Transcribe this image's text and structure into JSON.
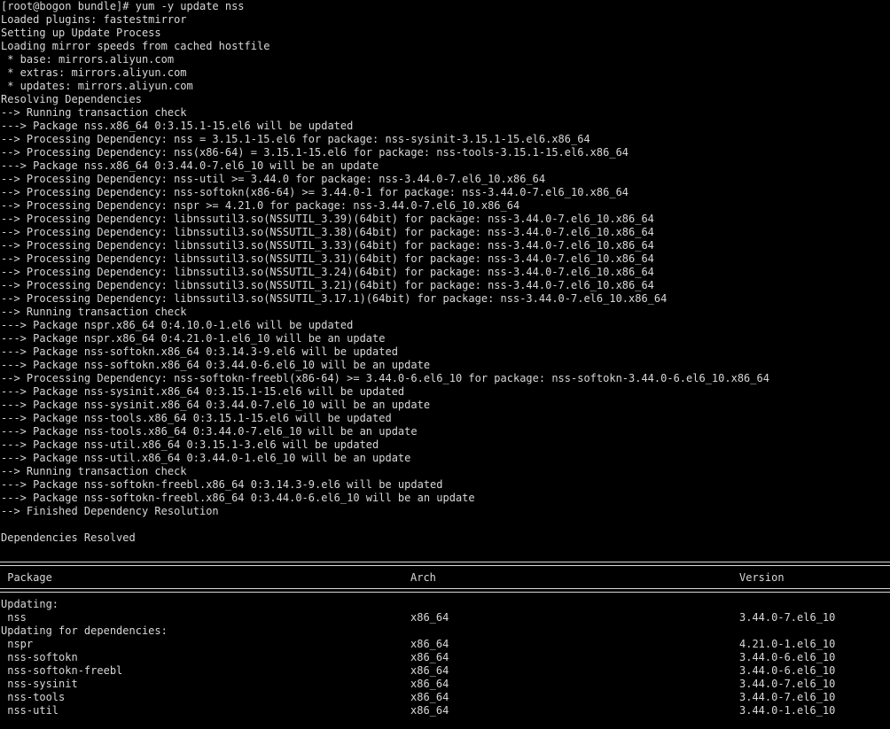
{
  "terminal": {
    "lines": [
      "[root@bogon bundle]# yum -y update nss",
      "Loaded plugins: fastestmirror",
      "Setting up Update Process",
      "Loading mirror speeds from cached hostfile",
      " * base: mirrors.aliyun.com",
      " * extras: mirrors.aliyun.com",
      " * updates: mirrors.aliyun.com",
      "Resolving Dependencies",
      "--> Running transaction check",
      "---> Package nss.x86_64 0:3.15.1-15.el6 will be updated",
      "--> Processing Dependency: nss = 3.15.1-15.el6 for package: nss-sysinit-3.15.1-15.el6.x86_64",
      "--> Processing Dependency: nss(x86-64) = 3.15.1-15.el6 for package: nss-tools-3.15.1-15.el6.x86_64",
      "---> Package nss.x86_64 0:3.44.0-7.el6_10 will be an update",
      "--> Processing Dependency: nss-util >= 3.44.0 for package: nss-3.44.0-7.el6_10.x86_64",
      "--> Processing Dependency: nss-softokn(x86-64) >= 3.44.0-1 for package: nss-3.44.0-7.el6_10.x86_64",
      "--> Processing Dependency: nspr >= 4.21.0 for package: nss-3.44.0-7.el6_10.x86_64",
      "--> Processing Dependency: libnssutil3.so(NSSUTIL_3.39)(64bit) for package: nss-3.44.0-7.el6_10.x86_64",
      "--> Processing Dependency: libnssutil3.so(NSSUTIL_3.38)(64bit) for package: nss-3.44.0-7.el6_10.x86_64",
      "--> Processing Dependency: libnssutil3.so(NSSUTIL_3.33)(64bit) for package: nss-3.44.0-7.el6_10.x86_64",
      "--> Processing Dependency: libnssutil3.so(NSSUTIL_3.31)(64bit) for package: nss-3.44.0-7.el6_10.x86_64",
      "--> Processing Dependency: libnssutil3.so(NSSUTIL_3.24)(64bit) for package: nss-3.44.0-7.el6_10.x86_64",
      "--> Processing Dependency: libnssutil3.so(NSSUTIL_3.21)(64bit) for package: nss-3.44.0-7.el6_10.x86_64",
      "--> Processing Dependency: libnssutil3.so(NSSUTIL_3.17.1)(64bit) for package: nss-3.44.0-7.el6_10.x86_64",
      "--> Running transaction check",
      "---> Package nspr.x86_64 0:4.10.0-1.el6 will be updated",
      "---> Package nspr.x86_64 0:4.21.0-1.el6_10 will be an update",
      "---> Package nss-softokn.x86_64 0:3.14.3-9.el6 will be updated",
      "---> Package nss-softokn.x86_64 0:3.44.0-6.el6_10 will be an update",
      "--> Processing Dependency: nss-softokn-freebl(x86-64) >= 3.44.0-6.el6_10 for package: nss-softokn-3.44.0-6.el6_10.x86_64",
      "---> Package nss-sysinit.x86_64 0:3.15.1-15.el6 will be updated",
      "---> Package nss-sysinit.x86_64 0:3.44.0-7.el6_10 will be an update",
      "---> Package nss-tools.x86_64 0:3.15.1-15.el6 will be updated",
      "---> Package nss-tools.x86_64 0:3.44.0-7.el6_10 will be an update",
      "---> Package nss-util.x86_64 0:3.15.1-3.el6 will be updated",
      "---> Package nss-util.x86_64 0:3.44.0-1.el6_10 will be an update",
      "--> Running transaction check",
      "---> Package nss-softokn-freebl.x86_64 0:3.14.3-9.el6 will be updated",
      "---> Package nss-softokn-freebl.x86_64 0:3.44.0-6.el6_10 will be an update",
      "--> Finished Dependency Resolution",
      "",
      "Dependencies Resolved",
      ""
    ],
    "table": {
      "headers": {
        "package": " Package",
        "arch": "Arch",
        "version": "Version"
      },
      "sections": [
        {
          "label": "Updating:",
          "rows": [
            {
              "package": " nss",
              "arch": "x86_64",
              "version": "3.44.0-7.el6_10"
            }
          ]
        },
        {
          "label": "Updating for dependencies:",
          "rows": [
            {
              "package": " nspr",
              "arch": "x86_64",
              "version": "4.21.0-1.el6_10"
            },
            {
              "package": " nss-softokn",
              "arch": "x86_64",
              "version": "3.44.0-6.el6_10"
            },
            {
              "package": " nss-softokn-freebl",
              "arch": "x86_64",
              "version": "3.44.0-6.el6_10"
            },
            {
              "package": " nss-sysinit",
              "arch": "x86_64",
              "version": "3.44.0-7.el6_10"
            },
            {
              "package": " nss-tools",
              "arch": "x86_64",
              "version": "3.44.0-7.el6_10"
            },
            {
              "package": " nss-util",
              "arch": "x86_64",
              "version": "3.44.0-1.el6_10"
            }
          ]
        }
      ]
    }
  }
}
